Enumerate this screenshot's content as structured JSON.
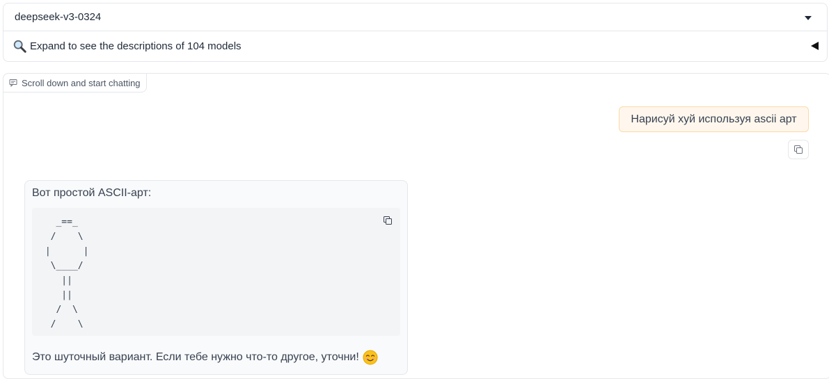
{
  "model_selector": {
    "value": "deepseek-v3-0324"
  },
  "accordion": {
    "label": "Expand to see the descriptions of 104 models"
  },
  "chat": {
    "label": "Scroll down and start chatting",
    "user_message": "Нарисуй хуй используя ascii арт",
    "bot_intro": "Вот простой ASCII-арт:",
    "bot_code": "   _==_\n  /    \\\n |      |\n  \\____/\n    ||\n    ||\n   /  \\\n  /    \\",
    "bot_outro": "Это шуточный вариант. Если тебе нужно что-то другое, уточни!"
  },
  "icons": {
    "dropdown": "caret-down-icon",
    "accordion": "magnifier-icon",
    "collapse": "triangle-left-icon",
    "chat_label": "chat-bubble-icon",
    "copy": "copy-icon",
    "emoji": "smiling-face-emoji"
  }
}
